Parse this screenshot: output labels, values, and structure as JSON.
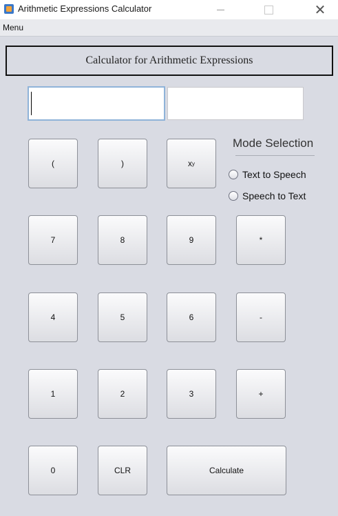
{
  "window": {
    "title": "Arithmetic Expressions Calculator",
    "minimize": "—",
    "close": "✕"
  },
  "menu": {
    "items": [
      "Menu"
    ]
  },
  "header": {
    "title": "Calculator for Arithmetic Expressions"
  },
  "expression": {
    "value": ""
  },
  "result": {
    "value": ""
  },
  "keys": {
    "open_paren": "(",
    "close_paren": ")",
    "power_base": "x",
    "power_exp": "y",
    "seven": "7",
    "eight": "8",
    "nine": "9",
    "multiply": "*",
    "four": "4",
    "five": "5",
    "six": "6",
    "subtract": "-",
    "one": "1",
    "two": "2",
    "three": "3",
    "add": "+",
    "zero": "0",
    "clear": "CLR",
    "calculate": "Calculate"
  },
  "mode": {
    "title": "Mode Selection",
    "options": [
      "Text to Speech",
      "Speech to Text"
    ]
  },
  "colors": {
    "background": "#d9dbe3",
    "input_focus_border": "#8fb3d9"
  }
}
